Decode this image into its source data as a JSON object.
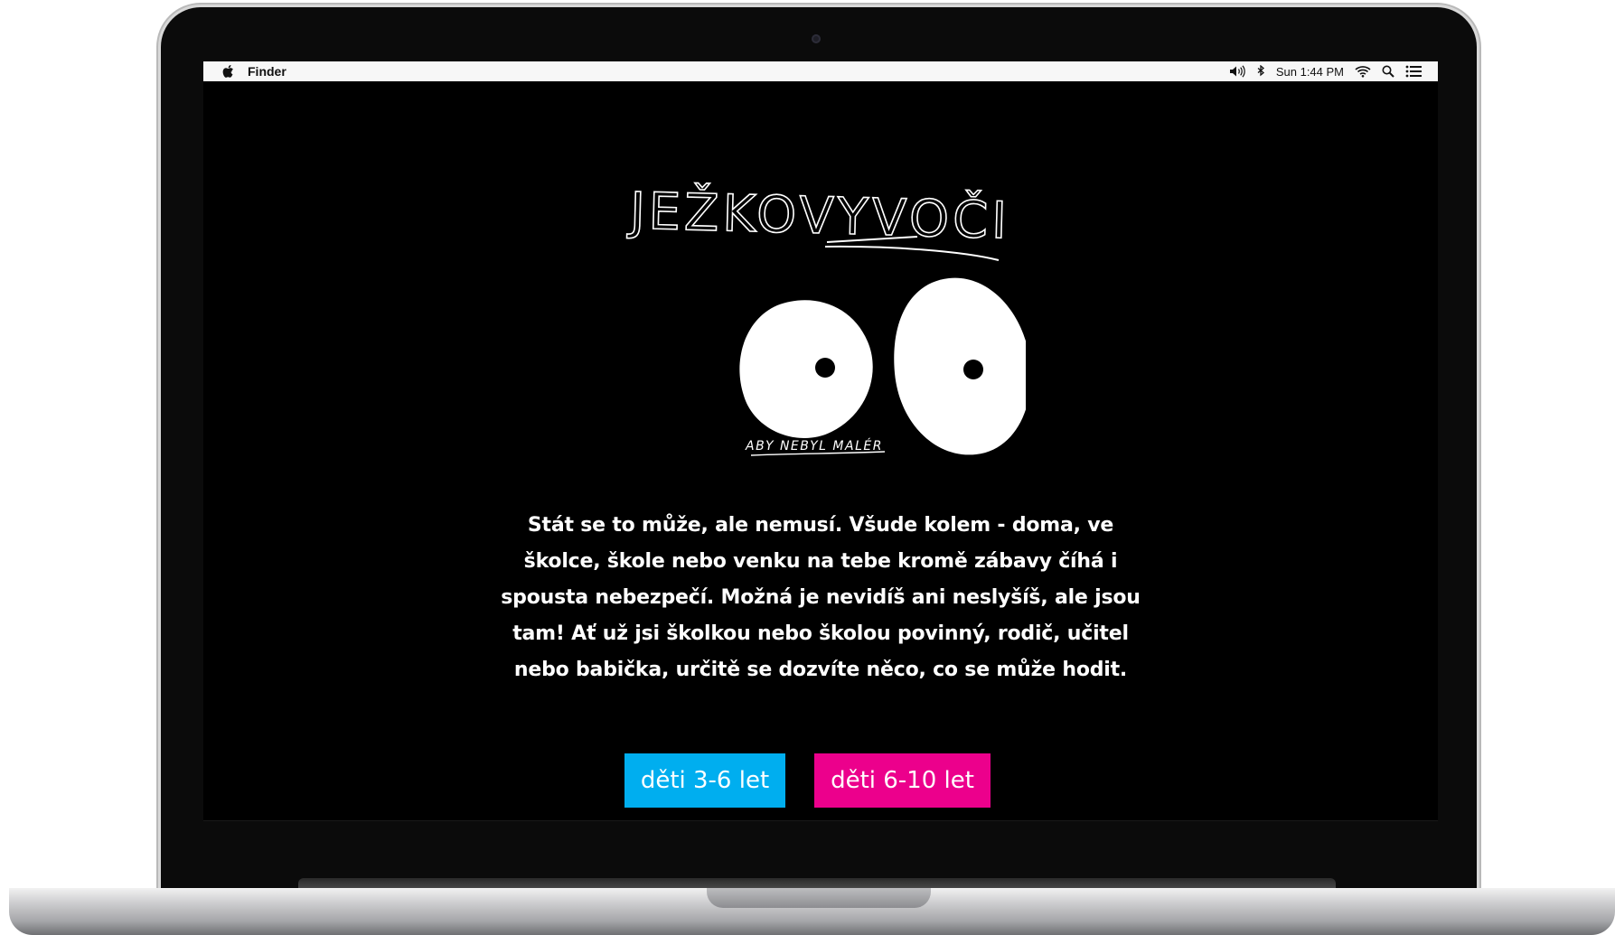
{
  "menubar": {
    "apple_icon": "apple-logo-icon",
    "app_name": "Finder",
    "status_icons": [
      "volume-icon",
      "bluetooth-icon"
    ],
    "clock": "Sun 1:44 PM",
    "right_icons": [
      "wifi-icon",
      "spotlight-search-icon",
      "notification-center-icon"
    ]
  },
  "site": {
    "logo_text": "JEŽKOVYVOČI",
    "tagline": "ABY NEBYL MALÉR",
    "intro": "Stát se to může, ale nemusí. Všude kolem - doma, ve školce, škole nebo venku na tebe kromě zábavy číhá i spousta nebezpečí. Možná je nevidíš ani neslyšíš, ale jsou tam! Ať už jsi školkou nebo školou povinný, rodič, učitel nebo babička, určitě se dozvíte něco, co se může hodit.",
    "buttons": [
      {
        "label": "děti 3-6 let",
        "color": "#00AEEF"
      },
      {
        "label": "děti 6-10 let",
        "color": "#EC008C"
      }
    ]
  },
  "colors": {
    "background": "#000000",
    "text": "#FFFFFF",
    "button_blue": "#00AEEF",
    "button_pink": "#EC008C"
  }
}
